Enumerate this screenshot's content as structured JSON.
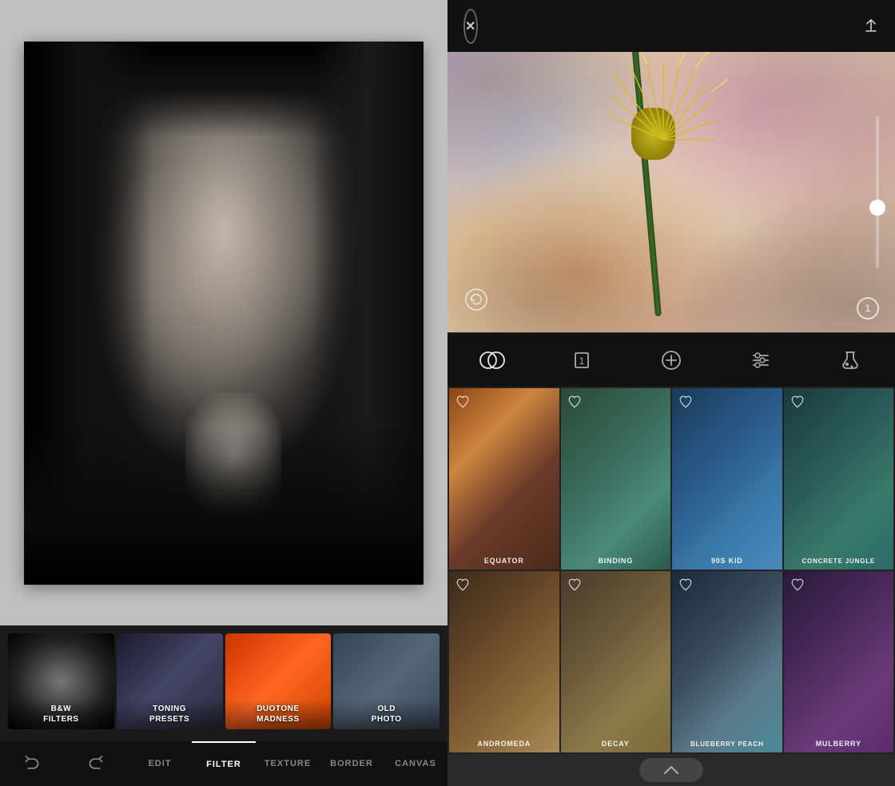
{
  "left": {
    "presets": [
      {
        "id": "bw-filters",
        "label": "B&W\nFILTERS",
        "style": "bw"
      },
      {
        "id": "toning-presets",
        "label": "TONING\nPRESETS",
        "style": "toning"
      },
      {
        "id": "duotone-madness",
        "label": "DUOTONE\nMADNESS",
        "style": "duo"
      },
      {
        "id": "old-photo",
        "label": "OLD\nPHOTO",
        "style": "old"
      }
    ],
    "toolbar": {
      "undo_label": "",
      "redo_label": "",
      "edit_label": "EDIT",
      "filter_label": "FILTER",
      "texture_label": "TEXTURE",
      "border_label": "BORDER",
      "canvas_label": "CANVAS"
    }
  },
  "right": {
    "header": {
      "close_label": "✕",
      "share_label": "↑"
    },
    "slider_value": "1",
    "tools": [
      {
        "id": "blend-tool",
        "label": "blend"
      },
      {
        "id": "layer-tool",
        "label": "layer"
      },
      {
        "id": "add-tool",
        "label": "add"
      },
      {
        "id": "adjust-tool",
        "label": "adjust"
      },
      {
        "id": "lab-tool",
        "label": "lab"
      }
    ],
    "textures": [
      {
        "id": "equator",
        "label": "EQUATOR",
        "style": "tex-equator"
      },
      {
        "id": "binding",
        "label": "BINDING",
        "style": "tex-binding"
      },
      {
        "id": "90s-kid",
        "label": "90S KID",
        "style": "tex-90skid"
      },
      {
        "id": "concrete-jungle",
        "label": "CONCRETE JUNGLE",
        "style": "tex-concrete"
      },
      {
        "id": "andromeda",
        "label": "ANDROMEDA",
        "style": "tex-andromeda"
      },
      {
        "id": "decay",
        "label": "DECAY",
        "style": "tex-decay"
      },
      {
        "id": "blueberry-peach",
        "label": "BLUEBERRY PEACH",
        "style": "tex-blueberry"
      },
      {
        "id": "mulberry",
        "label": "MULBERRY",
        "style": "tex-mulberry"
      }
    ]
  }
}
